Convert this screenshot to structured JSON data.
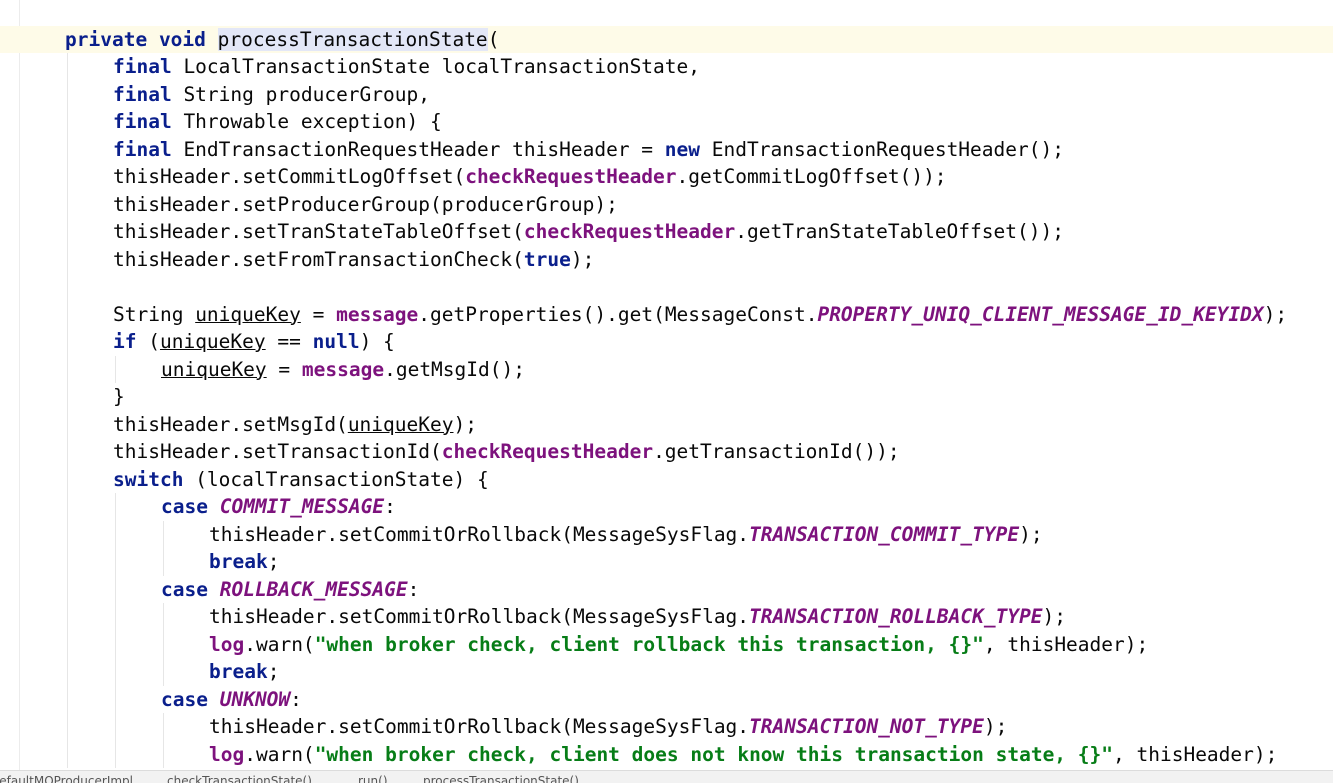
{
  "editor": {
    "lines": [
      {
        "indent": 1,
        "current": true,
        "tokens": [
          {
            "t": "private",
            "c": "kw"
          },
          {
            "t": " "
          },
          {
            "t": "void",
            "c": "kw"
          },
          {
            "t": " "
          },
          {
            "t": "processTransactionState",
            "c": "hl"
          },
          {
            "t": "("
          }
        ]
      },
      {
        "indent": 2,
        "tokens": [
          {
            "t": "final",
            "c": "kw"
          },
          {
            "t": " LocalTransactionState localTransactionState,"
          }
        ]
      },
      {
        "indent": 2,
        "tokens": [
          {
            "t": "final",
            "c": "kw"
          },
          {
            "t": " String producerGroup,"
          }
        ]
      },
      {
        "indent": 2,
        "tokens": [
          {
            "t": "final",
            "c": "kw"
          },
          {
            "t": " Throwable exception) {"
          }
        ]
      },
      {
        "indent": 2,
        "tokens": [
          {
            "t": "final",
            "c": "kw"
          },
          {
            "t": " EndTransactionRequestHeader thisHeader = "
          },
          {
            "t": "new",
            "c": "kw"
          },
          {
            "t": " EndTransactionRequestHeader();"
          }
        ]
      },
      {
        "indent": 2,
        "tokens": [
          {
            "t": "thisHeader.setCommitLogOffset("
          },
          {
            "t": "checkRequestHeader",
            "c": "fld"
          },
          {
            "t": ".getCommitLogOffset());"
          }
        ]
      },
      {
        "indent": 2,
        "tokens": [
          {
            "t": "thisHeader.setProducerGroup(producerGroup);"
          }
        ]
      },
      {
        "indent": 2,
        "tokens": [
          {
            "t": "thisHeader.setTranStateTableOffset("
          },
          {
            "t": "checkRequestHeader",
            "c": "fld"
          },
          {
            "t": ".getTranStateTableOffset());"
          }
        ]
      },
      {
        "indent": 2,
        "tokens": [
          {
            "t": "thisHeader.setFromTransactionCheck("
          },
          {
            "t": "true",
            "c": "kw"
          },
          {
            "t": ");"
          }
        ]
      },
      {
        "indent": 2,
        "tokens": []
      },
      {
        "indent": 2,
        "tokens": [
          {
            "t": "String "
          },
          {
            "t": "uniqueKey",
            "c": "var"
          },
          {
            "t": " = "
          },
          {
            "t": "message",
            "c": "fld"
          },
          {
            "t": ".getProperties().get(MessageConst."
          },
          {
            "t": "PROPERTY_UNIQ_CLIENT_MESSAGE_ID_KEYIDX",
            "c": "const"
          },
          {
            "t": ");"
          }
        ]
      },
      {
        "indent": 2,
        "tokens": [
          {
            "t": "if",
            "c": "kw"
          },
          {
            "t": " ("
          },
          {
            "t": "uniqueKey",
            "c": "var"
          },
          {
            "t": " == "
          },
          {
            "t": "null",
            "c": "kw"
          },
          {
            "t": ") {"
          }
        ]
      },
      {
        "indent": 3,
        "tokens": [
          {
            "t": "uniqueKey",
            "c": "var"
          },
          {
            "t": " = "
          },
          {
            "t": "message",
            "c": "fld"
          },
          {
            "t": ".getMsgId();"
          }
        ]
      },
      {
        "indent": 2,
        "tokens": [
          {
            "t": "}"
          }
        ]
      },
      {
        "indent": 2,
        "tokens": [
          {
            "t": "thisHeader.setMsgId("
          },
          {
            "t": "uniqueKey",
            "c": "var"
          },
          {
            "t": ");"
          }
        ]
      },
      {
        "indent": 2,
        "tokens": [
          {
            "t": "thisHeader.setTransactionId("
          },
          {
            "t": "checkRequestHeader",
            "c": "fld"
          },
          {
            "t": ".getTransactionId());"
          }
        ]
      },
      {
        "indent": 2,
        "tokens": [
          {
            "t": "switch",
            "c": "kw"
          },
          {
            "t": " (localTransactionState) {"
          }
        ]
      },
      {
        "indent": 3,
        "tokens": [
          {
            "t": "case",
            "c": "kw"
          },
          {
            "t": " "
          },
          {
            "t": "COMMIT_MESSAGE",
            "c": "const"
          },
          {
            "t": ":"
          }
        ]
      },
      {
        "indent": 4,
        "tokens": [
          {
            "t": "thisHeader.setCommitOrRollback(MessageSysFlag."
          },
          {
            "t": "TRANSACTION_COMMIT_TYPE",
            "c": "const"
          },
          {
            "t": ");"
          }
        ]
      },
      {
        "indent": 4,
        "tokens": [
          {
            "t": "break",
            "c": "kw"
          },
          {
            "t": ";"
          }
        ]
      },
      {
        "indent": 3,
        "tokens": [
          {
            "t": "case",
            "c": "kw"
          },
          {
            "t": " "
          },
          {
            "t": "ROLLBACK_MESSAGE",
            "c": "const"
          },
          {
            "t": ":"
          }
        ]
      },
      {
        "indent": 4,
        "tokens": [
          {
            "t": "thisHeader.setCommitOrRollback(MessageSysFlag."
          },
          {
            "t": "TRANSACTION_ROLLBACK_TYPE",
            "c": "const"
          },
          {
            "t": ");"
          }
        ]
      },
      {
        "indent": 4,
        "tokens": [
          {
            "t": "log",
            "c": "fld"
          },
          {
            "t": ".warn("
          },
          {
            "t": "\"when broker check, client rollback this transaction, {}\"",
            "c": "str"
          },
          {
            "t": ", thisHeader);"
          }
        ]
      },
      {
        "indent": 4,
        "tokens": [
          {
            "t": "break",
            "c": "kw"
          },
          {
            "t": ";"
          }
        ]
      },
      {
        "indent": 3,
        "tokens": [
          {
            "t": "case",
            "c": "kw"
          },
          {
            "t": " "
          },
          {
            "t": "UNKNOW",
            "c": "const"
          },
          {
            "t": ":"
          }
        ]
      },
      {
        "indent": 4,
        "tokens": [
          {
            "t": "thisHeader.setCommitOrRollback(MessageSysFlag."
          },
          {
            "t": "TRANSACTION_NOT_TYPE",
            "c": "const"
          },
          {
            "t": ");"
          }
        ]
      },
      {
        "indent": 4,
        "tokens": [
          {
            "t": "log",
            "c": "fld"
          },
          {
            "t": ".warn("
          },
          {
            "t": "\"when broker check, client does not know this transaction state, {}\"",
            "c": "str"
          },
          {
            "t": ", thisHeader);"
          }
        ]
      }
    ]
  },
  "breadcrumbs": [
    "DefaultMQProducerImpl",
    "checkTransactionState()",
    "run()",
    "processTransactionState()"
  ]
}
